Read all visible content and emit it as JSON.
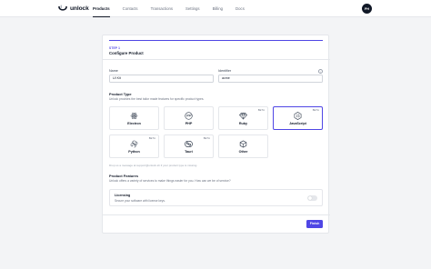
{
  "brand": {
    "name": "unlock",
    "logo_icon": "unlock-logo-icon"
  },
  "nav": {
    "items": [
      {
        "label": "Products",
        "active": true
      },
      {
        "label": "Contacts",
        "active": false
      },
      {
        "label": "Transactions",
        "active": false
      },
      {
        "label": "Settings",
        "active": false
      },
      {
        "label": "Billing",
        "active": false
      },
      {
        "label": "Docs",
        "active": false
      }
    ],
    "avatar_initials": "PH"
  },
  "wizard": {
    "step": "STEP 1",
    "title": "Configure Product",
    "accent_color": "#4f46e5"
  },
  "form": {
    "name": {
      "label": "Name",
      "value": "UI Kit"
    },
    "identifier": {
      "label": "Identifier",
      "value": "acme",
      "info_icon": "info-icon"
    }
  },
  "product_type": {
    "title": "Product Type",
    "description": "Unlock provides the best tailor made features for specific product types.",
    "options": [
      {
        "name": "Electron",
        "icon": "electron-icon",
        "beta": "",
        "selected": false
      },
      {
        "name": "PHP",
        "icon": "php-icon",
        "beta": "",
        "selected": false
      },
      {
        "name": "Ruby",
        "icon": "ruby-icon",
        "beta": "BETA",
        "selected": false
      },
      {
        "name": "JavaScript",
        "icon": "javascript-icon",
        "beta": "BETA",
        "selected": true
      },
      {
        "name": "Python",
        "icon": "python-icon",
        "beta": "BETA",
        "selected": false
      },
      {
        "name": "Tauri",
        "icon": "tauri-icon",
        "beta": "BETA",
        "selected": false
      },
      {
        "name": "Other",
        "icon": "cube-icon",
        "beta": "",
        "selected": false
      }
    ],
    "hint": "Drop us a message at support@unlock.sh if your product type is missing."
  },
  "features": {
    "title": "Product Features",
    "description": "Unlock offers a variety of services to make things easier for you. How can we be of service?",
    "items": [
      {
        "name": "Licensing",
        "description": "Secure your software with license keys.",
        "enabled": false
      }
    ]
  },
  "actions": {
    "finish_label": "Finish"
  }
}
